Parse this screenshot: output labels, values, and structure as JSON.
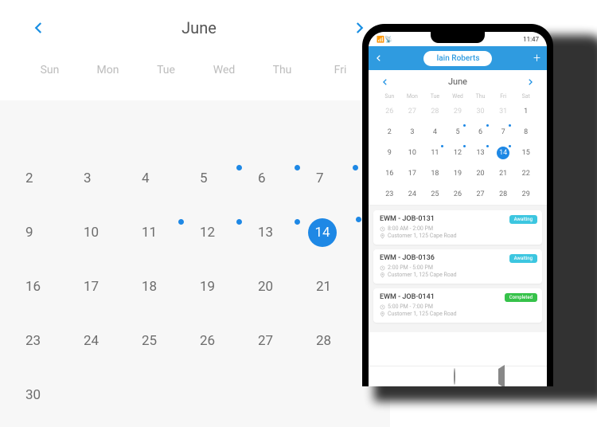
{
  "big_calendar": {
    "month": "June",
    "day_names": [
      "Sun",
      "Mon",
      "Tue",
      "Wed",
      "Thu",
      "Fri"
    ],
    "weeks": [
      [
        {
          "n": "",
          "blank": true
        },
        {
          "n": "",
          "blank": true
        },
        {
          "n": "",
          "blank": true
        },
        {
          "n": "",
          "blank": true
        },
        {
          "n": "",
          "blank": true
        },
        {
          "n": "",
          "blank": true
        }
      ],
      [
        {
          "n": "2"
        },
        {
          "n": "3"
        },
        {
          "n": "4"
        },
        {
          "n": "5",
          "dot": true
        },
        {
          "n": "6",
          "dot": true
        },
        {
          "n": "7",
          "dot": true
        }
      ],
      [
        {
          "n": "9"
        },
        {
          "n": "10"
        },
        {
          "n": "11",
          "dot": true
        },
        {
          "n": "12",
          "dot": true
        },
        {
          "n": "13",
          "dot": true
        },
        {
          "n": "14",
          "dot": true,
          "selected": true
        }
      ],
      [
        {
          "n": "16"
        },
        {
          "n": "17"
        },
        {
          "n": "18"
        },
        {
          "n": "19"
        },
        {
          "n": "20"
        },
        {
          "n": "21"
        }
      ],
      [
        {
          "n": "23"
        },
        {
          "n": "24"
        },
        {
          "n": "25"
        },
        {
          "n": "26"
        },
        {
          "n": "27"
        },
        {
          "n": "28"
        }
      ],
      [
        {
          "n": "30"
        },
        {
          "n": "",
          "blank": true
        },
        {
          "n": "",
          "blank": true
        },
        {
          "n": "",
          "blank": true
        },
        {
          "n": "",
          "blank": true
        },
        {
          "n": "",
          "blank": true
        }
      ]
    ]
  },
  "phone": {
    "status": {
      "time": "11:47"
    },
    "header": {
      "user": "Iain Roberts"
    },
    "mini_calendar": {
      "month": "June",
      "day_names": [
        "Sun",
        "Mon",
        "Tue",
        "Wed",
        "Thu",
        "Fri",
        "Sat"
      ],
      "weeks": [
        [
          {
            "n": "26",
            "other": true
          },
          {
            "n": "27",
            "other": true
          },
          {
            "n": "28",
            "other": true
          },
          {
            "n": "29",
            "other": true
          },
          {
            "n": "30",
            "other": true
          },
          {
            "n": "31",
            "other": true
          },
          {
            "n": "1"
          }
        ],
        [
          {
            "n": "2"
          },
          {
            "n": "3"
          },
          {
            "n": "4"
          },
          {
            "n": "5",
            "dot": true
          },
          {
            "n": "6",
            "dot": true
          },
          {
            "n": "7",
            "dot": true
          },
          {
            "n": "8"
          }
        ],
        [
          {
            "n": "9"
          },
          {
            "n": "10"
          },
          {
            "n": "11",
            "dot": true
          },
          {
            "n": "12",
            "dot": true
          },
          {
            "n": "13",
            "dot": true
          },
          {
            "n": "14",
            "dot": true,
            "selected": true
          },
          {
            "n": "15"
          }
        ],
        [
          {
            "n": "16"
          },
          {
            "n": "17"
          },
          {
            "n": "18"
          },
          {
            "n": "19"
          },
          {
            "n": "20"
          },
          {
            "n": "21"
          },
          {
            "n": "22"
          }
        ],
        [
          {
            "n": "23"
          },
          {
            "n": "24"
          },
          {
            "n": "25"
          },
          {
            "n": "26"
          },
          {
            "n": "27"
          },
          {
            "n": "28"
          },
          {
            "n": "29"
          }
        ]
      ]
    },
    "jobs": [
      {
        "title": "EWM - JOB-0131",
        "time": "8:00 AM - 2:00 PM",
        "location": "Customer 1, 125 Cape Road",
        "status": "Awaiting",
        "status_kind": "aw"
      },
      {
        "title": "EWM - JOB-0136",
        "time": "2:00 PM - 5:00 PM",
        "location": "Customer 1, 125 Cape Road",
        "status": "Awaiting",
        "status_kind": "aw"
      },
      {
        "title": "EWM - JOB-0141",
        "time": "5:00 PM - 7:00 PM",
        "location": "Customer 1, 125 Cape Road",
        "status": "Completed",
        "status_kind": "cp"
      }
    ]
  }
}
